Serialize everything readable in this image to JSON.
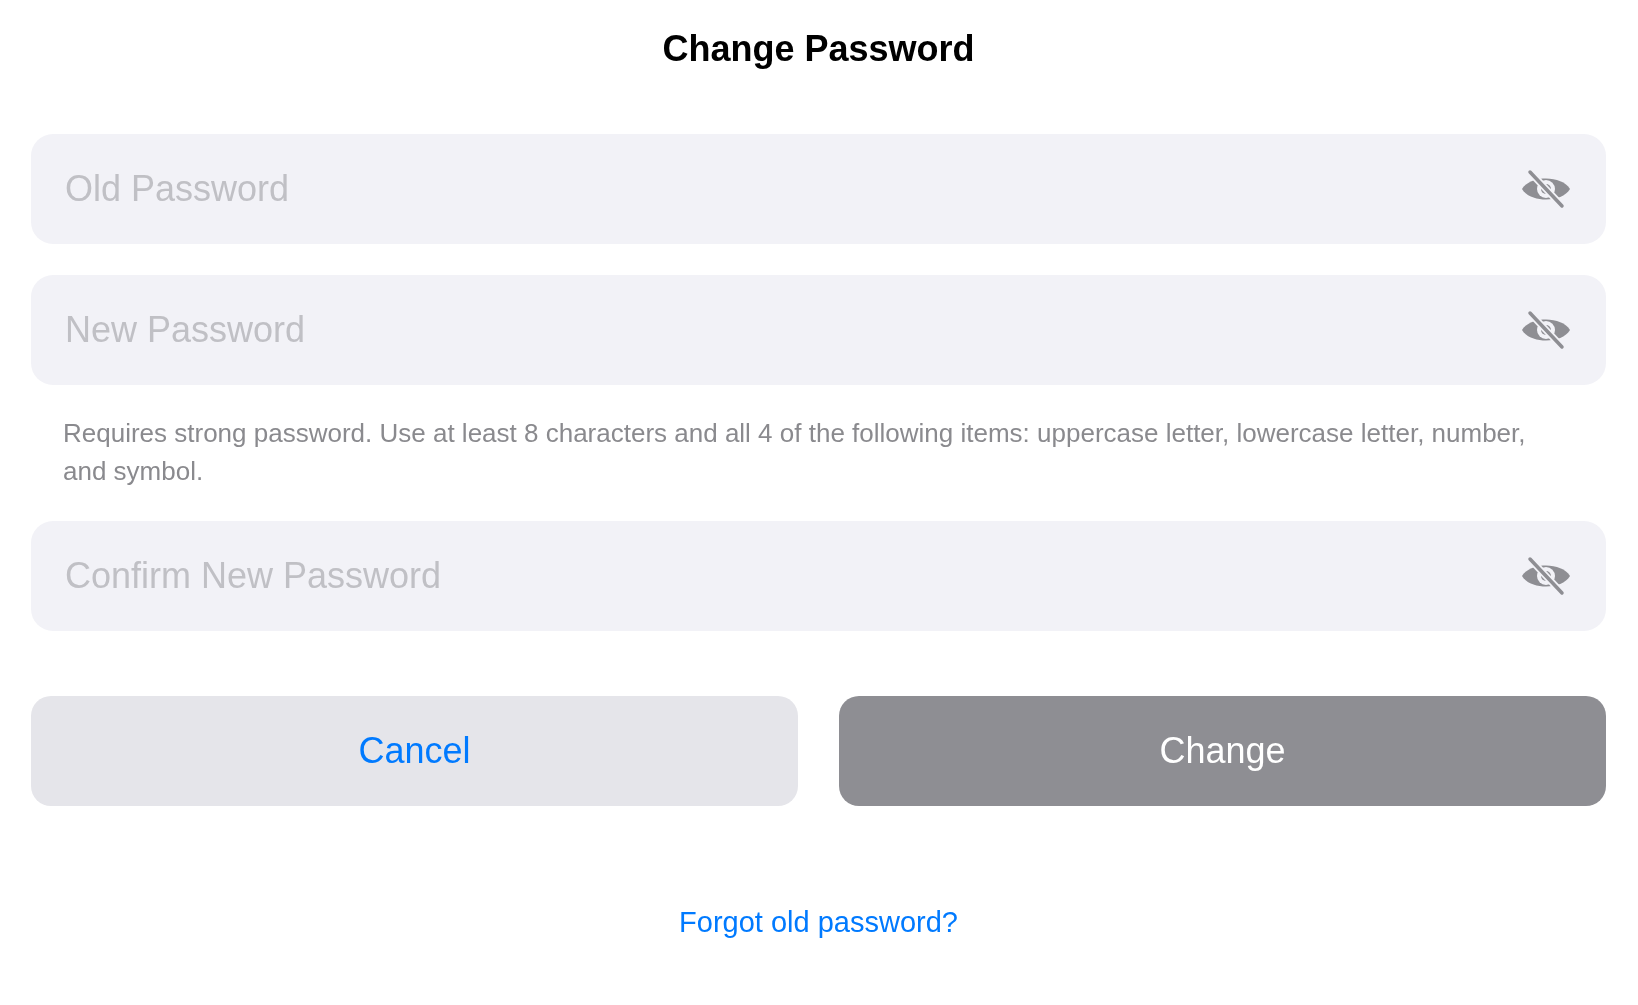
{
  "title": "Change Password",
  "fields": [
    {
      "placeholder": "Old Password",
      "revealed": false
    },
    {
      "placeholder": "New Password",
      "revealed": false,
      "hint": "Requires strong password. Use at least 8 characters and all 4 of the following items: uppercase letter, lowercase letter, number, and symbol."
    },
    {
      "placeholder": "Confirm New Password",
      "revealed": false
    }
  ],
  "buttons": [
    {
      "label": "Cancel",
      "kind": "secondary",
      "disabled": false
    },
    {
      "label": "Change",
      "kind": "primary",
      "disabled": true
    }
  ],
  "link": "Forgot old password?"
}
